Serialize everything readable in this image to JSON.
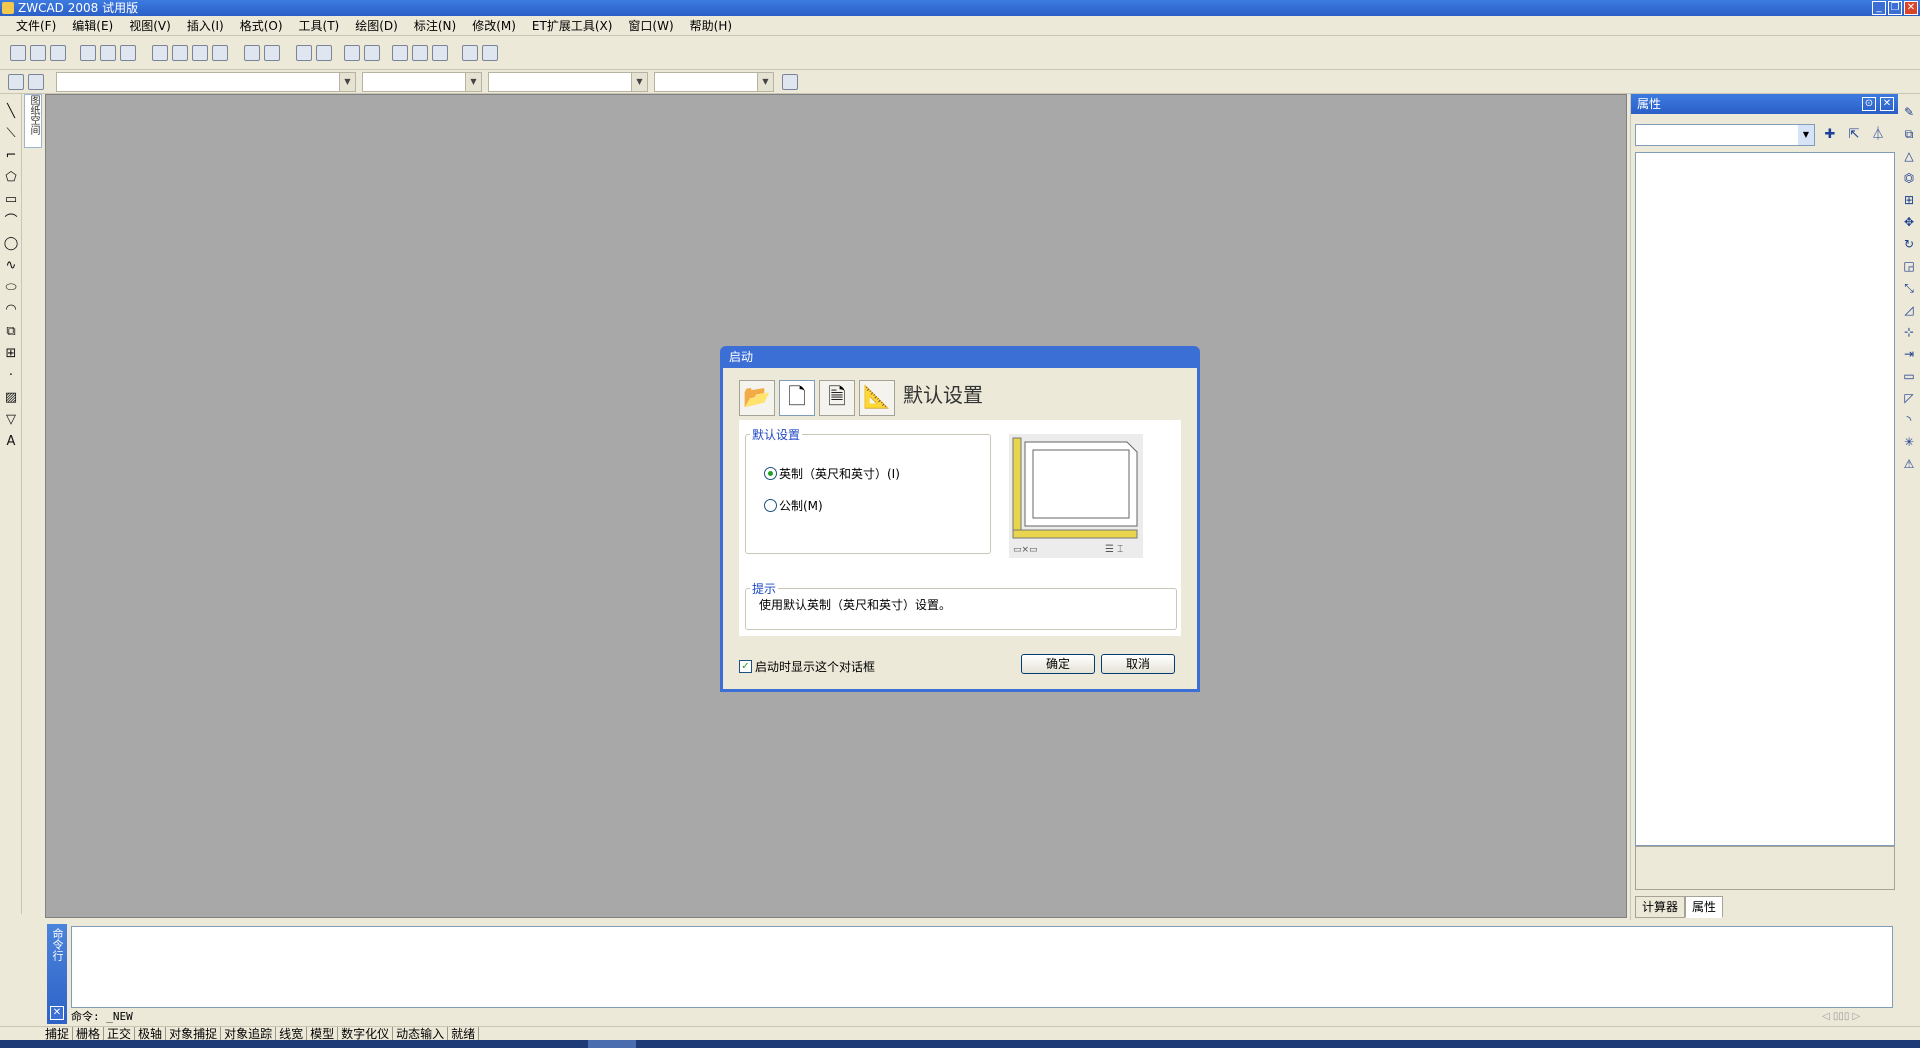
{
  "window": {
    "title": "ZWCAD 2008 试用版"
  },
  "menu": [
    "文件(F)",
    "编辑(E)",
    "视图(V)",
    "插入(I)",
    "格式(O)",
    "工具(T)",
    "绘图(D)",
    "标注(N)",
    "修改(M)",
    "ET扩展工具(X)",
    "窗口(W)",
    "帮助(H)"
  ],
  "side_tab": "图纸空间",
  "properties": {
    "title": "属性",
    "tabs": [
      "计算器",
      "属性"
    ],
    "active_tab": "属性"
  },
  "command": {
    "label": "命令行",
    "line": "命令: _NEW"
  },
  "status": [
    "捕捉",
    "栅格",
    "正交",
    "极轴",
    "对象捕捉",
    "对象追踪",
    "线宽",
    "模型",
    "数字化仪",
    "动态输入",
    "就绪"
  ],
  "dialog": {
    "title": "启动",
    "heading": "默认设置",
    "group_label": "默认设置",
    "options": [
      {
        "label": "英制（英尺和英寸）(I)",
        "selected": true
      },
      {
        "label": "公制(M)",
        "selected": false
      }
    ],
    "hint_label": "提示",
    "hint_text": "使用默认英制（英尺和英寸）设置。",
    "show_on_start_label": "启动时显示这个对话框",
    "show_on_start_checked": true,
    "ok_label": "确定",
    "cancel_label": "取消"
  }
}
